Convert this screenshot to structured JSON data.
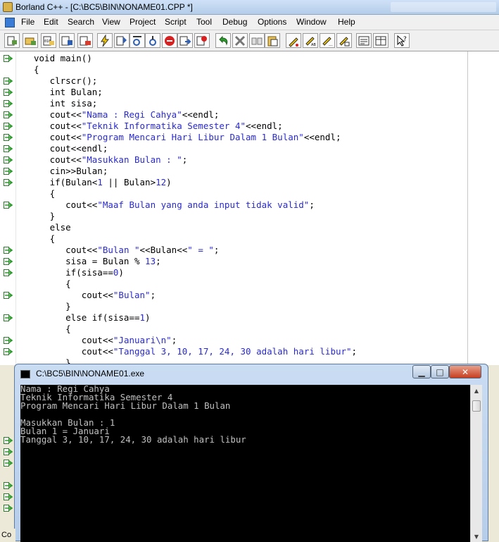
{
  "window": {
    "title": "Borland C++ - [C:\\BC5\\BIN\\NONAME01.CPP *]"
  },
  "menu": [
    "File",
    "Edit",
    "Search",
    "View",
    "Project",
    "Script",
    "Tool",
    "Debug",
    "Options",
    "Window",
    "Help"
  ],
  "toolbar": {
    "buttons": [
      "new-file",
      "open-file",
      "save-file",
      "make",
      "compile",
      "step-over",
      "trace-into",
      "stop",
      "goto",
      "find",
      "undo",
      "cut",
      "copy",
      "paste",
      "toggle-breakpoint",
      "evaluate",
      "inspect",
      "watch",
      "message-window",
      "project-window",
      "help-topic"
    ]
  },
  "editor": {
    "lines": [
      "void main()",
      "{",
      "   clrscr();",
      "   int Bulan;",
      "   int sisa;",
      "   cout<<\"Nama : Regi Cahya\"<<endl;",
      "   cout<<\"Teknik Informatika Semester 4\"<<endl;",
      "   cout<<\"Program Mencari Hari Libur Dalam 1 Bulan\"<<endl;",
      "   cout<<endl;",
      "   cout<<\"Masukkan Bulan : \";",
      "   cin>>Bulan;",
      "   if(Bulan<1 || Bulan>12)",
      "   {",
      "      cout<<\"Maaf Bulan yang anda input tidak valid\";",
      "   }",
      "   else",
      "   {",
      "      cout<<\"Bulan \"<<Bulan<<\" = \";",
      "      sisa = Bulan % 13;",
      "      if(sisa==0)",
      "      {",
      "         cout<<\"Bulan\";",
      "      }",
      "      else if(sisa==1)",
      "      {",
      "         cout<<\"Januari\\n\";",
      "         cout<<\"Tanggal 3, 10, 17, 24, 30 adalah hari libur\";",
      "      }"
    ],
    "breakpoint_lines": [
      0,
      2,
      3,
      4,
      5,
      6,
      7,
      8,
      9,
      10,
      11,
      13,
      17,
      18,
      19,
      21,
      23,
      25,
      26
    ],
    "string_color": "#2a2acc"
  },
  "console": {
    "title": "C:\\BC5\\BIN\\NONAME01.exe",
    "output": "Nama : Regi Cahya\nTeknik Informatika Semester 4\nProgram Mencari Hari Libur Dalam 1 Bulan\n\nMasukkan Bulan : 1\nBulan 1 = Januari\nTanggal 3, 10, 17, 24, 30 adalah hari libur",
    "min_label": "▁",
    "max_label": "□",
    "close_label": "✕"
  },
  "lower_gutter_icons": 7,
  "status": {
    "left_text": "Co"
  }
}
